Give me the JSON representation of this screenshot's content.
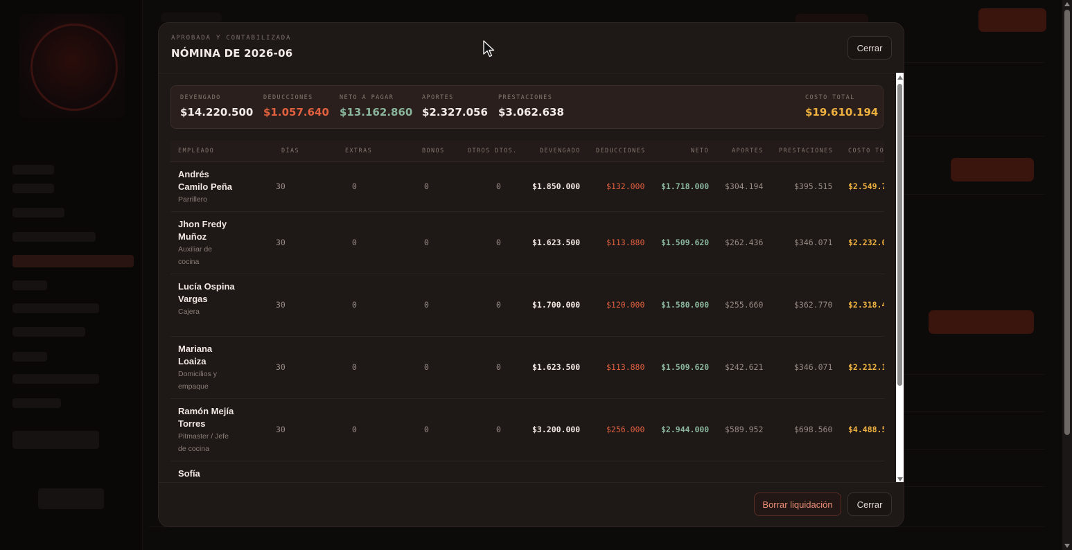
{
  "modal": {
    "eyebrow": "APROBADA Y CONTABILIZADA",
    "title": "NÓMINA DE 2026-06",
    "close_top_label": "Cerrar",
    "delete_label": "Borrar liquidación",
    "close_bottom_label": "Cerrar"
  },
  "summary": {
    "devengado": {
      "label": "DEVENGADO",
      "value": "$14.220.500"
    },
    "deducciones": {
      "label": "DEDUCCIONES",
      "value": "$1.057.640"
    },
    "neto": {
      "label": "NETO A PAGAR",
      "value": "$13.162.860"
    },
    "aportes": {
      "label": "APORTES",
      "value": "$2.327.056"
    },
    "prestaciones": {
      "label": "PRESTACIONES",
      "value": "$3.062.638"
    },
    "costo": {
      "label": "COSTO TOTAL",
      "value": "$19.610.194"
    }
  },
  "table": {
    "headers": [
      "EMPLEADO",
      "DÍAS",
      "EXTRAS",
      "BONOS",
      "OTROS DTOS.",
      "DEVENGADO",
      "DEDUCCIONES",
      "NETO",
      "APORTES",
      "PRESTACIONES",
      "COSTO TO"
    ],
    "rows": [
      {
        "name": "Andrés Camilo Peña",
        "role": "Parrillero",
        "dias": "30",
        "extras": "0",
        "bonos": "0",
        "otros": "0",
        "devengado": "$1.850.000",
        "deducciones": "$132.000",
        "neto": "$1.718.000",
        "aportes": "$304.194",
        "prestaciones": "$395.515",
        "costo": "$2.549.7"
      },
      {
        "name": "Jhon Fredy Muñoz",
        "role": "Auxiliar de cocina",
        "dias": "30",
        "extras": "0",
        "bonos": "0",
        "otros": "0",
        "devengado": "$1.623.500",
        "deducciones": "$113.880",
        "neto": "$1.509.620",
        "aportes": "$262.436",
        "prestaciones": "$346.071",
        "costo": "$2.232.0"
      },
      {
        "name": "Lucía Ospina Vargas",
        "role": "Cajera",
        "dias": "30",
        "extras": "0",
        "bonos": "0",
        "otros": "0",
        "devengado": "$1.700.000",
        "deducciones": "$120.000",
        "neto": "$1.580.000",
        "aportes": "$255.660",
        "prestaciones": "$362.770",
        "costo": "$2.318.4"
      },
      {
        "name": "Mariana Loaiza",
        "role": "Domicilios y empaque",
        "dias": "30",
        "extras": "0",
        "bonos": "0",
        "otros": "0",
        "devengado": "$1.623.500",
        "deducciones": "$113.880",
        "neto": "$1.509.620",
        "aportes": "$242.621",
        "prestaciones": "$346.071",
        "costo": "$2.212.1"
      },
      {
        "name": "Ramón Mejía Torres",
        "role": "Pitmaster / Jefe de cocina",
        "dias": "30",
        "extras": "0",
        "bonos": "0",
        "otros": "0",
        "devengado": "$3.200.000",
        "deducciones": "$256.000",
        "neto": "$2.944.000",
        "aportes": "$589.952",
        "prestaciones": "$698.560",
        "costo": "$4.488.5"
      },
      {
        "name": "Sofía",
        "role": "",
        "dias": "",
        "extras": "",
        "bonos": "",
        "otros": "",
        "devengado": "",
        "deducciones": "",
        "neto": "",
        "aportes": "",
        "prestaciones": "",
        "costo": ""
      }
    ]
  }
}
